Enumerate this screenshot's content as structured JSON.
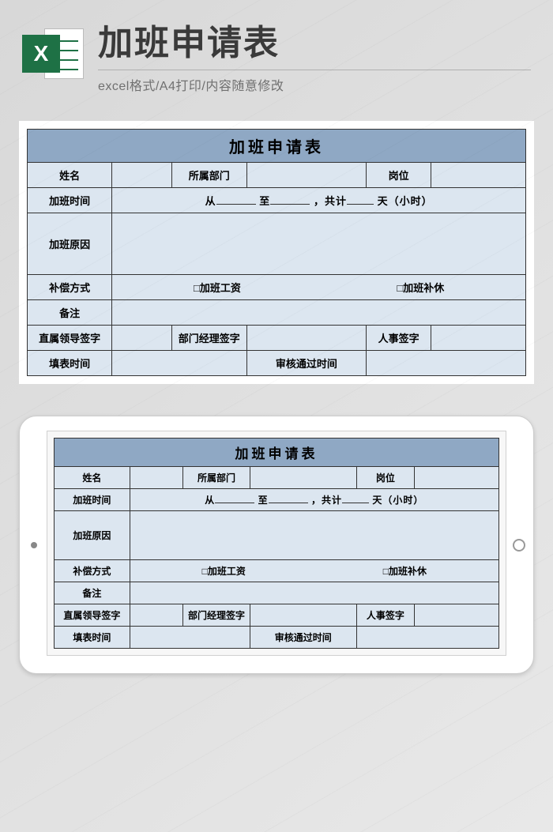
{
  "header": {
    "icon_letter": "X",
    "title": "加班申请表",
    "subtitle": "excel格式/A4打印/内容随意修改"
  },
  "form": {
    "title": "加班申请表",
    "labels": {
      "name": "姓名",
      "department": "所属部门",
      "position": "岗位",
      "overtime_time": "加班时间",
      "overtime_reason": "加班原因",
      "compensation": "补偿方式",
      "remark": "备注",
      "direct_leader_sign": "直属领导签字",
      "dept_manager_sign": "部门经理签字",
      "hr_sign": "人事签字",
      "fill_time": "填表时间",
      "approve_time": "审核通过时间"
    },
    "time_line": {
      "from": "从",
      "to": "至",
      "total_prefix": "，共计",
      "total_suffix": "天（小时）"
    },
    "compensation_options": {
      "pay": "□加班工资",
      "rest": "□加班补休"
    }
  }
}
